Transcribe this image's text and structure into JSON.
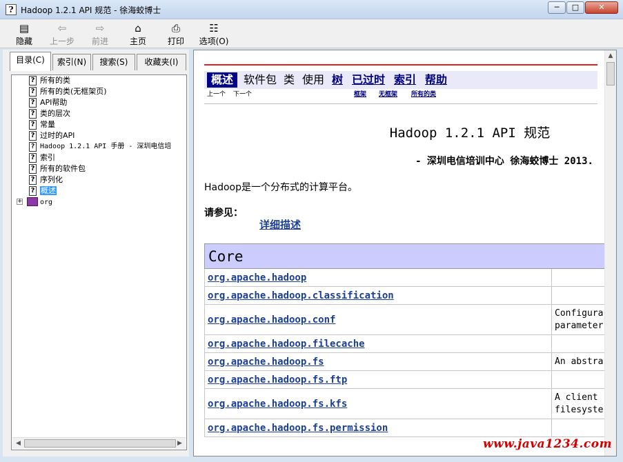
{
  "window": {
    "title": "Hadoop 1.2.1 API 规范 - 徐海蛟博士",
    "app_icon": "help-book-icon",
    "buttons": {
      "minimize": "─",
      "maximize": "□",
      "close": "✕"
    }
  },
  "toolbar": {
    "hide": "隐藏",
    "back": "上一步",
    "forward": "前进",
    "home": "主页",
    "print": "打印",
    "options": "选项(O)"
  },
  "left": {
    "tabs": [
      "目录(C)",
      "索引(N)",
      "搜索(S)",
      "收藏夹(I)"
    ],
    "tree": [
      "所有的类",
      "所有的类(无框架页)",
      "API帮助",
      "类的层次",
      "常量",
      "过时的API",
      "Hadoop 1.2.1 API 手册 - 深圳电信培",
      "索引",
      "所有的软件包",
      "序列化",
      "概述"
    ],
    "tree_book": "org"
  },
  "doc": {
    "nav": {
      "overview": "概述",
      "package": "软件包",
      "class": "类",
      "use": "使用",
      "tree": "树",
      "deprecated": "已过时",
      "index": "索引",
      "help": "帮助"
    },
    "subnav": {
      "prev": "上一个",
      "next": "下一个",
      "frames": "框架",
      "noframes": "无框架",
      "allclasses": "所有的类"
    },
    "title": "Hadoop 1.2.1 API 规范",
    "subtitle": "- 深圳电信培训中心 徐海蛟博士 2013.",
    "description": "Hadoop是一个分布式的计算平台。",
    "see_also": "请参见：",
    "detail_link": "详细描述",
    "table_header": "Core",
    "packages": [
      {
        "name": "org.apache.hadoop",
        "desc": ""
      },
      {
        "name": "org.apache.hadoop.classification",
        "desc": ""
      },
      {
        "name": "org.apache.hadoop.conf",
        "desc": "Configura\nparameter"
      },
      {
        "name": "org.apache.hadoop.filecache",
        "desc": ""
      },
      {
        "name": "org.apache.hadoop.fs",
        "desc": "An abstra"
      },
      {
        "name": "org.apache.hadoop.fs.ftp",
        "desc": ""
      },
      {
        "name": "org.apache.hadoop.fs.kfs",
        "desc": "A client\nfilesyste"
      },
      {
        "name": "org.apache.hadoop.fs.permission",
        "desc": ""
      }
    ]
  },
  "watermark": "www.java1234.com"
}
